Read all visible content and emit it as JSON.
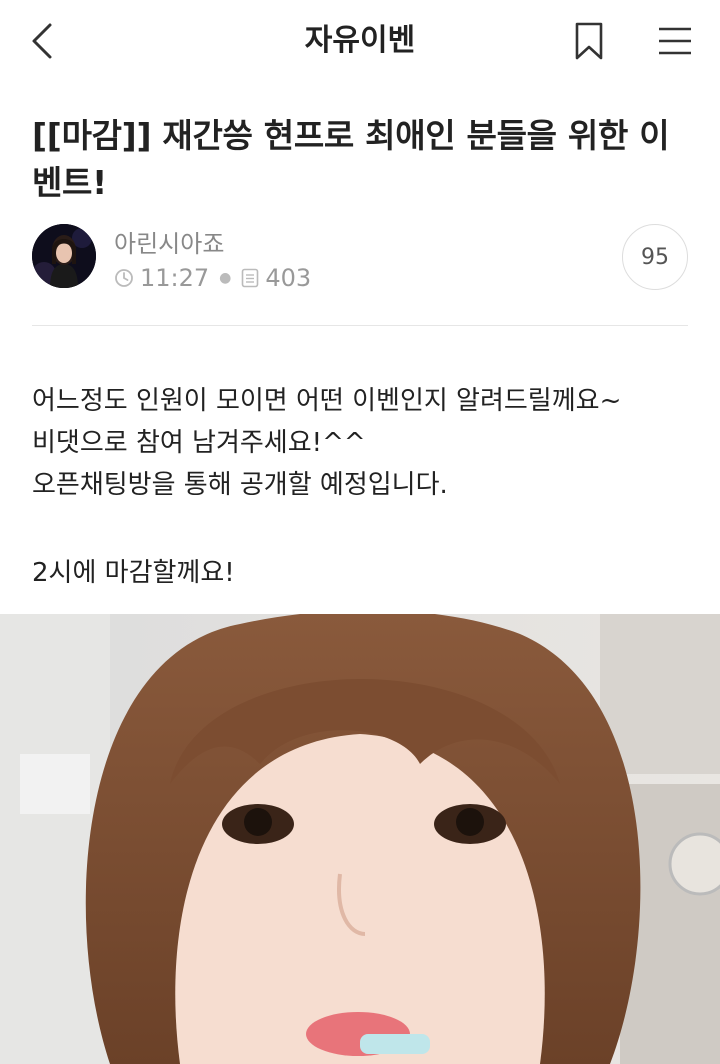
{
  "header": {
    "title": "자유이벤",
    "back_icon": "chevron-left-icon",
    "bookmark_icon": "bookmark-icon",
    "menu_icon": "hamburger-menu-icon"
  },
  "post": {
    "title": "[[마감]] 재간씅 현프로 최애인 분들을 위한 이벤트!",
    "author": "아린시아죠",
    "time": "11:27",
    "views": "403",
    "comment_count": "95",
    "body_lines": [
      "어느정도 인원이 모이면 어떤 이벤인지 알려드릴께요~",
      "비댓으로 참여 남겨주세요!^^",
      "오픈채팅방을 통해 공개할 예정입니다.",
      "",
      "2시에 마감할께요!"
    ]
  },
  "colors": {
    "text": "#222222",
    "meta": "#999999",
    "divider": "#e6e6e6"
  }
}
